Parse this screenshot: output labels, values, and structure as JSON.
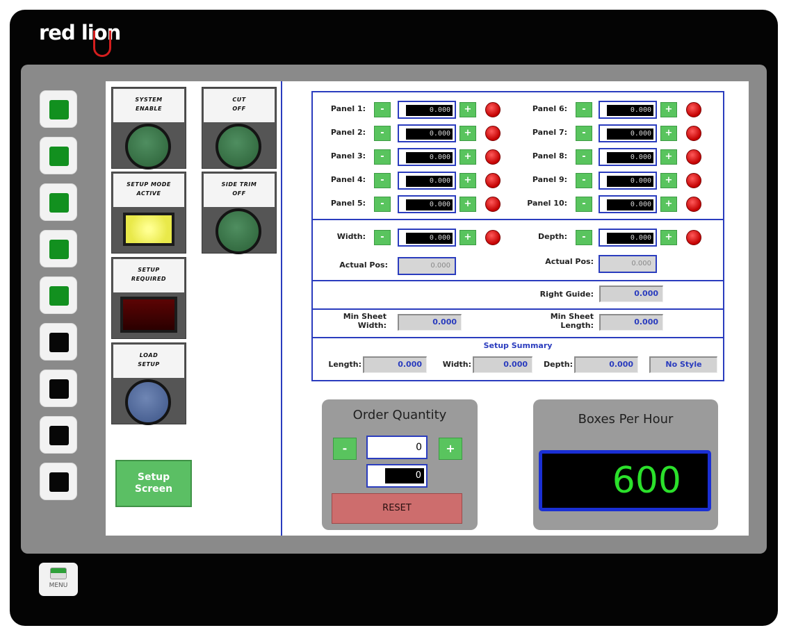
{
  "brand": "red lion",
  "side_buttons": [
    {
      "state": "on"
    },
    {
      "state": "on"
    },
    {
      "state": "on"
    },
    {
      "state": "on"
    },
    {
      "state": "on"
    },
    {
      "state": "off"
    },
    {
      "state": "off"
    },
    {
      "state": "off"
    },
    {
      "state": "off"
    }
  ],
  "menu_label": "MENU",
  "indicators": {
    "system_enable": "SYSTEM\nENABLE",
    "cut_off": "CUT\nOFF",
    "setup_mode_active": "SETUP MODE\nACTIVE",
    "side_trim_off": "SIDE TRIM\nOFF",
    "setup_required": "SETUP\nREQUIRED",
    "load_setup": "LOAD\nSETUP"
  },
  "setup_screen_label": "Setup\nScreen",
  "colors": {
    "accent_blue": "#2a3cbe",
    "button_green": "#59c45e",
    "lamp_red": "#c30000"
  },
  "panels": [
    {
      "label": "Panel 1:",
      "value": "0.000"
    },
    {
      "label": "Panel 2:",
      "value": "0.000"
    },
    {
      "label": "Panel 3:",
      "value": "0.000"
    },
    {
      "label": "Panel 4:",
      "value": "0.000"
    },
    {
      "label": "Panel 5:",
      "value": "0.000"
    },
    {
      "label": "Panel 6:",
      "value": "0.000"
    },
    {
      "label": "Panel 7:",
      "value": "0.000"
    },
    {
      "label": "Panel 8:",
      "value": "0.000"
    },
    {
      "label": "Panel 9:",
      "value": "0.000"
    },
    {
      "label": "Panel 10:",
      "value": "0.000"
    }
  ],
  "minus": "-",
  "plus": "+",
  "width": {
    "label": "Width:",
    "value": "0.000",
    "actual_label": "Actual Pos:",
    "actual_value": "0.000"
  },
  "depth": {
    "label": "Depth:",
    "value": "0.000",
    "actual_label": "Actual Pos:",
    "actual_value": "0.000"
  },
  "right_guide": {
    "label": "Right Guide:",
    "value": "0.000"
  },
  "min_sheet_width": {
    "label": "Min Sheet\nWidth:",
    "value": "0.000"
  },
  "min_sheet_length": {
    "label": "Min Sheet\nLength:",
    "value": "0.000"
  },
  "setup_summary": {
    "title": "Setup Summary",
    "length_label": "Length:",
    "length_value": "0.000",
    "width_label": "Width:",
    "width_value": "0.000",
    "depth_label": "Depth:",
    "depth_value": "0.000",
    "style": "No Style"
  },
  "order_quantity": {
    "title": "Order Quantity",
    "value": "0",
    "count": "0",
    "reset_label": "RESET"
  },
  "boxes_per_hour": {
    "title": "Boxes Per Hour",
    "value": "600"
  }
}
